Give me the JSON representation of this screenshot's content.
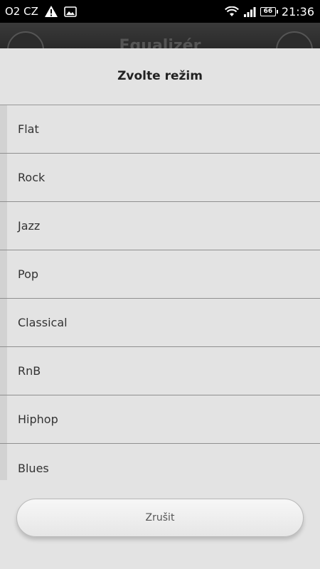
{
  "status_bar": {
    "carrier": "O2 CZ",
    "battery": "66",
    "time": "21:36",
    "icons": [
      "warning-icon",
      "image-icon",
      "wifi-icon",
      "signal-icon",
      "battery-icon"
    ]
  },
  "background_app": {
    "title": "Equalizér"
  },
  "dialog": {
    "title": "Zvolte režim",
    "items": [
      "Flat",
      "Rock",
      "Jazz",
      "Pop",
      "Classical",
      "RnB",
      "Hiphop",
      "Blues"
    ],
    "cancel_label": "Zrušit"
  }
}
